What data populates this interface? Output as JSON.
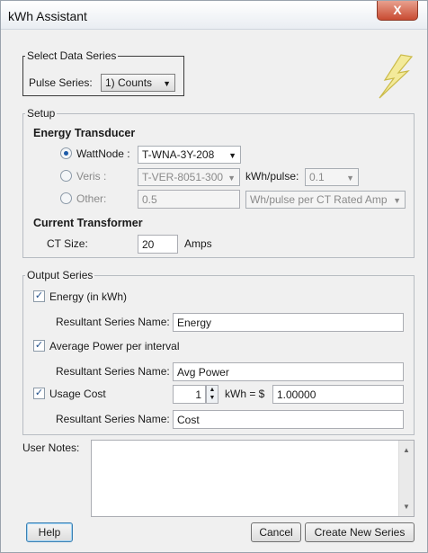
{
  "window": {
    "title": "kWh Assistant",
    "close_glyph": "X"
  },
  "select_series": {
    "legend": "Select Data Series",
    "label": "Pulse Series:",
    "value": "1) Counts"
  },
  "setup": {
    "legend": "Setup",
    "energy_transducer": "Energy Transducer",
    "wattnode": {
      "label": "WattNode :",
      "value": "T-WNA-3Y-208"
    },
    "veris": {
      "label": "Veris :",
      "value": "T-VER-8051-300",
      "kwh_pulse_label": "kWh/pulse:",
      "kwh_pulse_value": "0.1"
    },
    "other": {
      "label": "Other:",
      "value": "0.5",
      "unit": "Wh/pulse per CT Rated Amp"
    },
    "current_transformer": "Current Transformer",
    "ct_size_label": "CT Size:",
    "ct_size_value": "20",
    "ct_unit": "Amps"
  },
  "output": {
    "legend": "Output Series",
    "energy": {
      "label": "Energy (in kWh)",
      "name_label": "Resultant Series Name:",
      "name_value": "Energy"
    },
    "avg_power": {
      "label": "Average Power per interval",
      "name_label": "Resultant Series Name:",
      "name_value": "Avg Power"
    },
    "usage_cost": {
      "label": "Usage Cost",
      "qty": "1",
      "kwh_eq": "kWh = $",
      "cost": "1.00000",
      "name_label": "Resultant Series Name:",
      "name_value": "Cost"
    }
  },
  "notes": {
    "label": "User Notes:"
  },
  "buttons": {
    "help": "Help",
    "cancel": "Cancel",
    "create": "Create New Series"
  },
  "colors": {
    "bolt": "#e8d86a",
    "close": "#c94b32"
  }
}
